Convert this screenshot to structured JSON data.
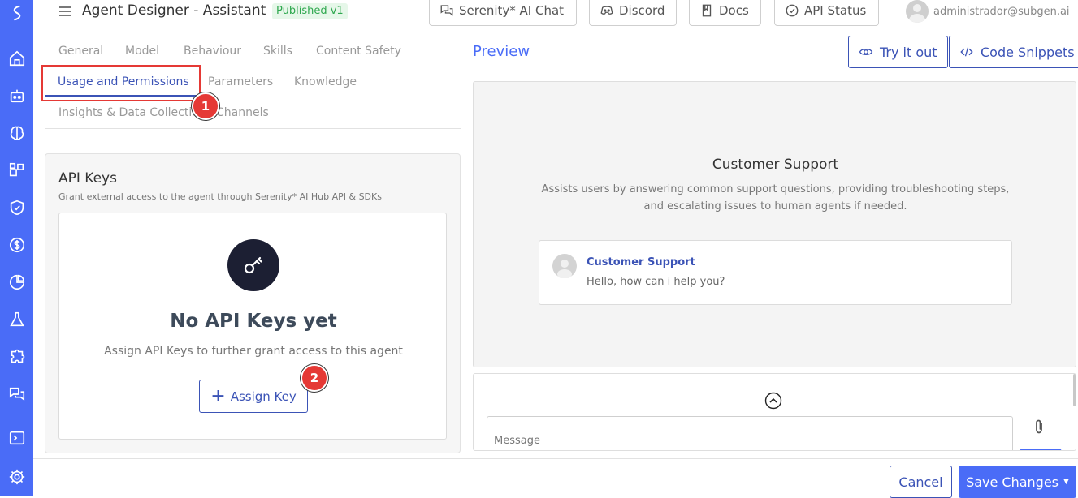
{
  "header": {
    "title": "Agent Designer - Assistant",
    "badge": "Published v1",
    "links": [
      {
        "label": "Serenity* AI Chat",
        "icon": "chat-icon"
      },
      {
        "label": "Discord",
        "icon": "discord-icon"
      },
      {
        "label": "Docs",
        "icon": "book-icon"
      },
      {
        "label": "API Status",
        "icon": "status-check-icon"
      }
    ],
    "user_email": "administrador@subgen.ai"
  },
  "sidebar": {
    "icons": [
      "logo-icon",
      "home-icon",
      "robot-icon",
      "brain-icon",
      "blocks-icon",
      "shield-icon",
      "dollar-icon",
      "pie-chart-icon",
      "flask-icon",
      "puzzle-icon",
      "chat-bubbles-icon",
      "terminal-icon",
      "gear-icon"
    ]
  },
  "tabs": {
    "row1": [
      "General",
      "Model",
      "Behaviour",
      "Skills",
      "Content Safety"
    ],
    "row2": [
      "Usage and Permissions",
      "Parameters",
      "Knowledge"
    ],
    "row3": [
      "Insights & Data Collection",
      "Channels"
    ],
    "active": "Usage and Permissions"
  },
  "markers": [
    "1",
    "2"
  ],
  "api_keys": {
    "title": "API Keys",
    "subtitle": "Grant external access to the agent through Serenity* AI Hub API & SDKs",
    "empty_title": "No API Keys yet",
    "empty_subtitle": "Assign API Keys to further grant access to this agent",
    "assign_button": "Assign Key"
  },
  "preview": {
    "title": "Preview",
    "try_button": "Try it out",
    "code_button": "Code Snippets",
    "agent_name": "Customer Support",
    "agent_description": "Assists users by answering common support questions, providing troubleshooting steps, and escalating issues to human agents if needed.",
    "chat_sender": "Customer Support",
    "chat_message": "Hello, how can i help you?",
    "input_placeholder": "Message"
  },
  "footer": {
    "cancel": "Cancel",
    "save": "Save Changes"
  },
  "colors": {
    "sidebar": "#4a6cf7",
    "accent": "#3b53b6",
    "badge_text": "#2fa84f",
    "marker": "#e53935"
  }
}
